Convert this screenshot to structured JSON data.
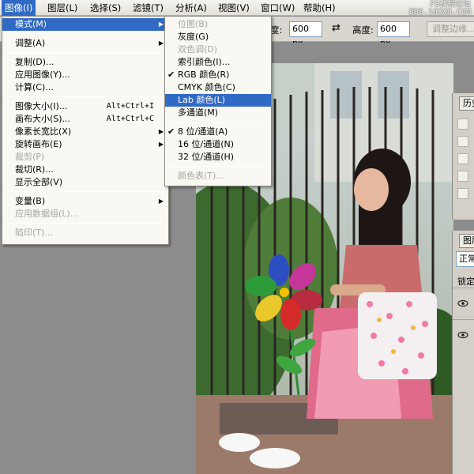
{
  "menubar": {
    "items": [
      "图像(I)",
      "图层(L)",
      "选择(S)",
      "滤镜(T)",
      "分析(A)",
      "视图(V)",
      "窗口(W)",
      "帮助(H)"
    ],
    "watermark_line1": "PS教程论坛",
    "watermark_line2": "BBS.16XX8.COM"
  },
  "options": {
    "width_label": "度:",
    "width_value": "600 px",
    "height_label": "高度:",
    "height_value": "600 px",
    "refine_label": "调整边缘..."
  },
  "image_menu": {
    "items": [
      {
        "label": "模式(M)",
        "submenu": true,
        "highlighted": true
      },
      {
        "label": "调整(A)",
        "submenu": true
      },
      {
        "label": "复制(D)..."
      },
      {
        "label": "应用图像(Y)..."
      },
      {
        "label": "计算(C)..."
      },
      {
        "label": "图像大小(I)...",
        "shortcut": "Alt+Ctrl+I"
      },
      {
        "label": "画布大小(S)...",
        "shortcut": "Alt+Ctrl+C"
      },
      {
        "label": "像素长宽比(X)",
        "submenu": true
      },
      {
        "label": "旋转画布(E)",
        "submenu": true
      },
      {
        "label": "裁剪(P)",
        "disabled": true
      },
      {
        "label": "裁切(R)..."
      },
      {
        "label": "显示全部(V)"
      },
      {
        "label": "变量(B)",
        "submenu": true
      },
      {
        "label": "应用数据组(L)...",
        "disabled": true
      },
      {
        "label": "陷印(T)...",
        "disabled": true
      }
    ]
  },
  "mode_submenu": {
    "items": [
      {
        "label": "位图(B)",
        "disabled": true
      },
      {
        "label": "灰度(G)"
      },
      {
        "label": "双色调(D)",
        "disabled": true
      },
      {
        "label": "索引颜色(I)..."
      },
      {
        "label": "RGB 颜色(R)",
        "checked": true
      },
      {
        "label": "CMYK 颜色(C)"
      },
      {
        "label": "Lab 颜色(L)",
        "highlighted": true
      },
      {
        "label": "多通道(M)"
      },
      {
        "label": "8 位/通道(A)",
        "checked": true
      },
      {
        "label": "16 位/通道(N)"
      },
      {
        "label": "32 位/通道(H)"
      },
      {
        "label": "颜色表(T)...",
        "disabled": true
      }
    ]
  },
  "panels": {
    "history_tab": "历史",
    "layers_tab": "图层",
    "blend_mode": "正常",
    "lock_label": "锁定:"
  },
  "icons": {
    "submenu_arrow": "submenu-arrow-icon",
    "check": "check-icon",
    "swap": "swap-arrows-icon",
    "eye": "eye-icon"
  },
  "colors": {
    "highlight": "#316ac5",
    "menu_bg": "#f9f8f3",
    "disabled_text": "#a7a59d"
  }
}
